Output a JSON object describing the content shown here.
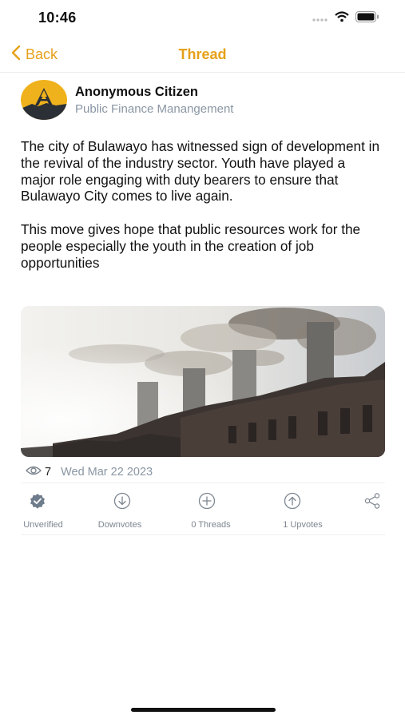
{
  "status_bar": {
    "time": "10:46"
  },
  "nav": {
    "back_label": "Back",
    "title": "Thread"
  },
  "author": {
    "name": "Anonymous Citizen",
    "organization": "Public Finance Manangement"
  },
  "post": {
    "paragraphs": [
      "The city of Bulawayo has witnessed sign of development in the revival of the industry sector.  Youth have played a major role engaging with duty bearers to ensure that Bulawayo City comes to live again.",
      "This move gives hope that public resources work for the people especially the youth in the creation of job opportunities"
    ],
    "views": "7",
    "date": "Wed Mar 22 2023"
  },
  "actions": {
    "unverified": "Unverified",
    "downvotes": "Downvotes",
    "threads": "0 Threads",
    "upvotes": "1 Upvotes"
  },
  "colors": {
    "accent": "#e6a019",
    "muted": "#8a96a3"
  }
}
